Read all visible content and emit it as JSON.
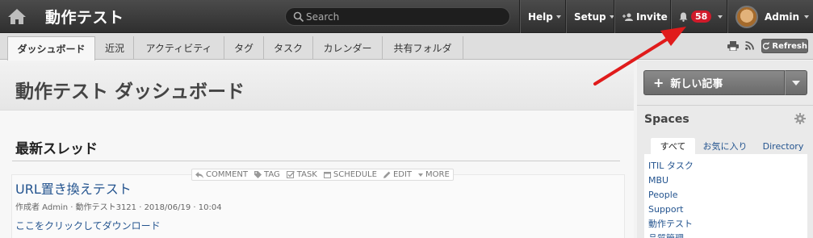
{
  "topbar": {
    "space_title": "動作テスト",
    "search_placeholder": "Search",
    "help_label": "Help",
    "setup_label": "Setup",
    "invite_label": "Invite",
    "notification_count": "58",
    "user_label": "Admin"
  },
  "tabs": [
    {
      "label": "ダッシュボード",
      "active": true
    },
    {
      "label": "近況"
    },
    {
      "label": "アクティビティ"
    },
    {
      "label": "タグ"
    },
    {
      "label": "タスク"
    },
    {
      "label": "カレンダー"
    },
    {
      "label": "共有フォルダ"
    }
  ],
  "toolbar": {
    "refresh_label": "Refresh",
    "icons": [
      "print-icon",
      "rss-icon",
      "refresh-icon"
    ]
  },
  "main": {
    "page_title": "動作テスト ダッシュボード",
    "section_title": "最新スレッド",
    "actions": [
      "COMMENT",
      "TAG",
      "TASK",
      "SCHEDULE",
      "EDIT",
      "MORE"
    ],
    "thread": {
      "title": "URL置き換えテスト",
      "meta": "作成者 Admin · 動作テスト3121 · 2018/06/19 · 10:04",
      "link": "ここをクリックしてダウンロード"
    }
  },
  "sidebar": {
    "new_post_label": "新しい記事",
    "spaces_title": "Spaces",
    "space_tabs": [
      "すべて",
      "お気に入り",
      "Directory"
    ],
    "space_items": [
      "ITIL タスク",
      "MBU",
      "People",
      "Support",
      "動作テスト",
      "品質管理"
    ]
  },
  "colors": {
    "topbar": "#3a3a3a",
    "badge": "#d01a2a",
    "link": "#24548f",
    "annotation_arrow": "#e01b1b"
  }
}
